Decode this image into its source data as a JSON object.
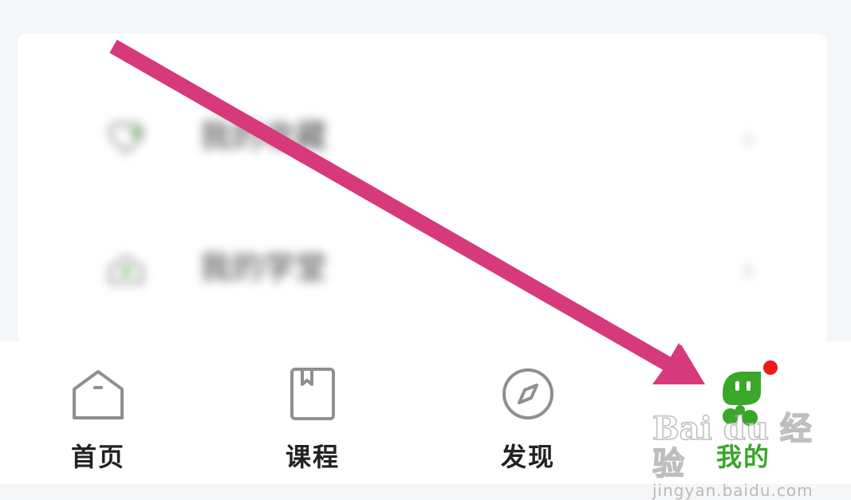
{
  "list": {
    "items": [
      {
        "label": "我的收藏",
        "icon": "heart-icon"
      },
      {
        "label": "我的学堂",
        "icon": "school-icon"
      }
    ],
    "chevron": "›"
  },
  "tabbar": {
    "tabs": [
      {
        "label": "首页",
        "icon": "home-icon",
        "active": false
      },
      {
        "label": "课程",
        "icon": "course-book-icon",
        "active": false
      },
      {
        "label": "发现",
        "icon": "compass-icon",
        "active": false
      },
      {
        "label": "我的",
        "icon": "profile-mascot-icon",
        "active": true,
        "badge": true
      }
    ]
  },
  "colors": {
    "accent": "#3aa62a",
    "badge": "#f01818",
    "arrow": "#d63a7a",
    "text": "#222222",
    "icon_inactive": "#8f8f8f"
  },
  "watermark": {
    "main": "Bai du 经验",
    "sub": "jingyan.baidu.com"
  }
}
